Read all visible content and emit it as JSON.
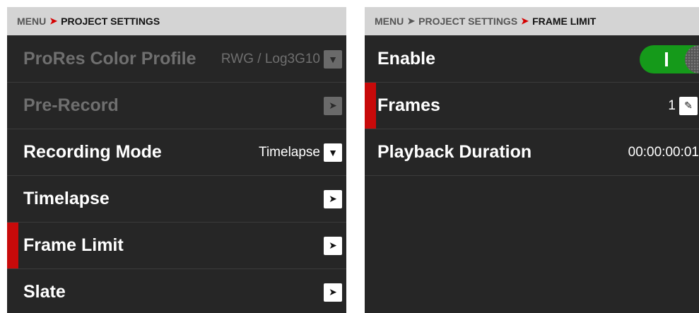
{
  "left": {
    "breadcrumb": {
      "root": "MENU",
      "separator": "➤",
      "current": "PROJECT SETTINGS"
    },
    "rows": [
      {
        "label": "ProRes Color Profile",
        "value": "RWG / Log3G10",
        "control": "▼"
      },
      {
        "label": "Pre-Record",
        "control": "➤"
      },
      {
        "label": "Recording Mode",
        "value": "Timelapse",
        "control": "▼"
      },
      {
        "label": "Timelapse",
        "control": "➤"
      },
      {
        "label": "Frame Limit",
        "control": "➤"
      },
      {
        "label": "Slate",
        "control": "➤"
      }
    ]
  },
  "right": {
    "breadcrumb": {
      "root": "MENU",
      "separator": "➤",
      "middle": "PROJECT SETTINGS",
      "current": "FRAME LIMIT"
    },
    "rows": [
      {
        "label": "Enable",
        "toggle_state": "on"
      },
      {
        "label": "Frames",
        "value": "1",
        "control": "✎"
      },
      {
        "label": "Playback Duration",
        "value": "00:00:00:01"
      }
    ]
  },
  "colors": {
    "accent_red": "#c80a0a",
    "toggle_green": "#159a1a",
    "panel_bg": "#262626",
    "breadcrumb_bg": "#d4d4d4"
  },
  "icons": {
    "dropdown": "chevron-down-icon",
    "submenu": "chevron-right-icon",
    "edit": "pencil-icon"
  }
}
